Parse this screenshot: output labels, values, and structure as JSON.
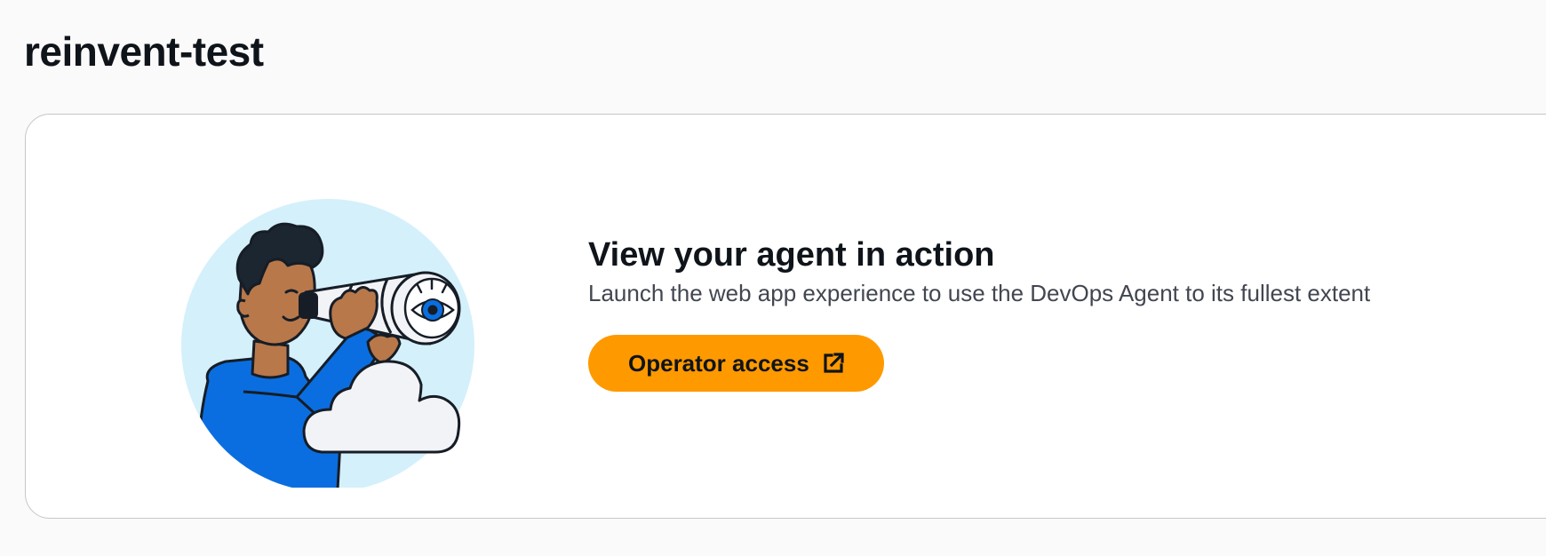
{
  "page": {
    "title": "reinvent-test"
  },
  "card": {
    "illustration_icon": "person-with-telescope-illustration",
    "heading": "View your agent in action",
    "description": "Launch the web app experience to use the DevOps Agent to its fullest extent",
    "button": {
      "label": "Operator access",
      "icon": "external-link-icon"
    }
  },
  "colors": {
    "background": "#fafafa",
    "card_background": "#ffffff",
    "card_border": "#c6c6cd",
    "primary_button": "#ff9900",
    "text_primary": "#0f141a",
    "text_secondary": "#424650",
    "illustration_circle": "#d4f0fb",
    "illustration_shirt": "#0a6ee0",
    "illustration_skin": "#b8784a",
    "illustration_hair": "#1c2630"
  }
}
